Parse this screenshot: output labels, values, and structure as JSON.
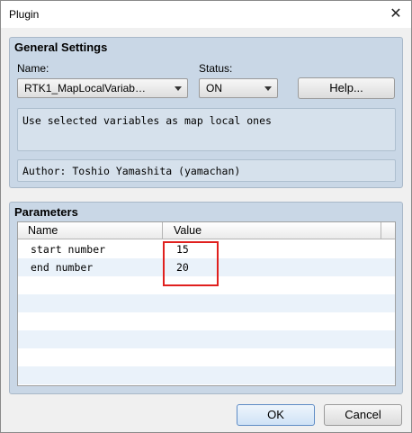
{
  "window": {
    "title": "Plugin"
  },
  "general": {
    "heading": "General Settings",
    "name_label": "Name:",
    "name_value": "RTK1_MapLocalVariab…",
    "status_label": "Status:",
    "status_value": "ON",
    "help_label": "Help...",
    "description": "Use selected variables as map local ones",
    "author": "Author: Toshio Yamashita (yamachan)"
  },
  "parameters": {
    "heading": "Parameters",
    "columns": [
      "Name",
      "Value"
    ],
    "rows": [
      {
        "name": "start number",
        "value": "15"
      },
      {
        "name": "end number",
        "value": "20"
      }
    ]
  },
  "footer": {
    "ok_label": "OK",
    "cancel_label": "Cancel"
  },
  "colors": {
    "panel": "#c9d7e6",
    "highlight": "#e0201e"
  },
  "icons": {
    "close": "close-icon",
    "dropdown": "chevron-down-icon"
  }
}
